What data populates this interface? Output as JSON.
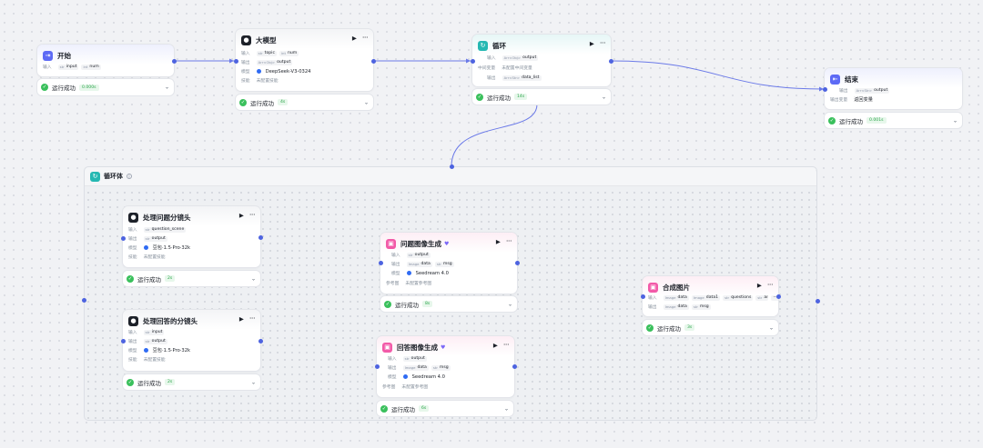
{
  "colors": {
    "edge": "#6b7ae8",
    "port": "#4d63e0",
    "success": "#3ac05c",
    "canvas": "#f1f2f5"
  },
  "labels": {
    "input": "输入",
    "output": "输出",
    "model": "模型",
    "skill": "技能",
    "intermediate": "中间变量",
    "output_var": "输出变量",
    "ref_image": "参考图"
  },
  "nodes": {
    "start": {
      "title": "开始",
      "icon": "start-icon",
      "inputs": [
        {
          "type": "str",
          "name": "input"
        },
        {
          "type": "int",
          "name": "num"
        }
      ],
      "status": "运行成功",
      "duration": "0.000s"
    },
    "llm": {
      "title": "大模型",
      "icon": "model-icon",
      "inputs": [
        {
          "type": "str",
          "name": "topic"
        },
        {
          "type": "int",
          "name": "num"
        }
      ],
      "outputs": [
        {
          "type": "Arr<Obj>",
          "name": "output"
        }
      ],
      "model": "DeepSeek-V3-0324",
      "skill": "未配置技能",
      "status": "运行成功",
      "duration": "4s"
    },
    "loop": {
      "title": "循环",
      "icon": "loop-icon",
      "inputs": [
        {
          "type": "Arr<Obj>",
          "name": "output"
        }
      ],
      "intermediate": "未配置中间变量",
      "outputs": [
        {
          "type": "Arr<Str>",
          "name": "data_list"
        }
      ],
      "status": "运行成功",
      "duration": "14s"
    },
    "end": {
      "title": "结束",
      "icon": "end-icon",
      "outputs": [
        {
          "type": "Arr<Str>",
          "name": "output"
        }
      ],
      "output_var": "返回变量",
      "status": "运行成功",
      "duration": "0.001s"
    },
    "loop_body": {
      "title": "循环体"
    },
    "q_scene": {
      "title": "处理问题分镜头",
      "icon": "model-icon",
      "inputs": [
        {
          "type": "str",
          "name": "question_scene"
        }
      ],
      "outputs": [
        {
          "type": "str",
          "name": "output"
        }
      ],
      "model": "豆包·1.5·Pro·32k",
      "skill": "未配置技能",
      "status": "运行成功",
      "duration": "2s"
    },
    "a_scene": {
      "title": "处理回答的分镜头",
      "icon": "model-icon",
      "inputs": [
        {
          "type": "str",
          "name": "input"
        }
      ],
      "outputs": [
        {
          "type": "str",
          "name": "output"
        }
      ],
      "model": "豆包·1.5·Pro·32k",
      "skill": "未配置技能",
      "status": "运行成功",
      "duration": "2s"
    },
    "q_image": {
      "title": "问题图像生成",
      "icon": "image-icon",
      "inputs": [
        {
          "type": "str",
          "name": "output"
        }
      ],
      "outputs": [
        {
          "type": "Image",
          "name": "data"
        },
        {
          "type": "str",
          "name": "msg"
        }
      ],
      "model": "Seedream 4.0",
      "ref": "未配置参考图",
      "status": "运行成功",
      "duration": "8s"
    },
    "a_image": {
      "title": "回答图像生成",
      "icon": "image-icon",
      "inputs": [
        {
          "type": "str",
          "name": "output"
        }
      ],
      "outputs": [
        {
          "type": "Image",
          "name": "data"
        },
        {
          "type": "str",
          "name": "msg"
        }
      ],
      "model": "Seedream 4.0",
      "ref": "未配置参考图",
      "status": "运行成功",
      "duration": "6s"
    },
    "compose": {
      "title": "合成图片",
      "icon": "image-icon",
      "inputs": [
        {
          "type": "Image",
          "name": "data"
        },
        {
          "type": "Image",
          "name": "data1"
        },
        {
          "type": "str",
          "name": "questions"
        },
        {
          "type": "str",
          "name": "answers"
        }
      ],
      "outputs": [
        {
          "type": "Image",
          "name": "data"
        },
        {
          "type": "str",
          "name": "msg"
        }
      ],
      "status": "运行成功",
      "duration": "3s"
    }
  }
}
